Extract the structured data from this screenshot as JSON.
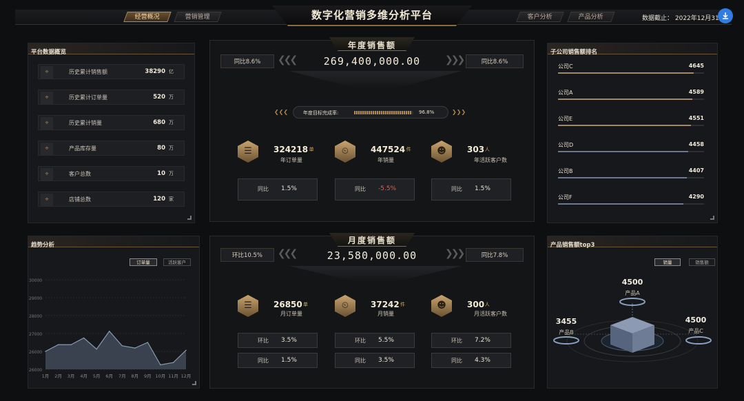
{
  "header": {
    "title": "数字化营销多维分析平台",
    "tabs_left": [
      "经营概况",
      "营销管理"
    ],
    "tabs_right": [
      "客户分析",
      "产品分析"
    ],
    "date_label": "数据截止：  2022年12月31日",
    "download_icon": "download-icon"
  },
  "overview": {
    "title": "平台数据概览",
    "items": [
      {
        "label": "历史累计销售额",
        "value": "38290",
        "unit": "亿"
      },
      {
        "label": "历史累计订单量",
        "value": "520",
        "unit": "万"
      },
      {
        "label": "历史累计销量",
        "value": "680",
        "unit": "万"
      },
      {
        "label": "产品库存量",
        "value": "80",
        "unit": "万"
      },
      {
        "label": "客户总数",
        "value": "10",
        "unit": "万"
      },
      {
        "label": "店铺总数",
        "value": "120",
        "unit": "家"
      }
    ]
  },
  "annual": {
    "title": "年度销售额",
    "yoy_left": "同比8.6%",
    "yoy_right": "同比8.6%",
    "value": "269,400,000.00",
    "target_label": "年度目标完成率:",
    "target_pct": "96.8%",
    "target_fraction": 0.968,
    "kpis": [
      {
        "value": "324218",
        "unit": "单",
        "label": "年订单量",
        "cmp_label": "同比",
        "cmp_value": "1.5%",
        "neg": false
      },
      {
        "value": "447524",
        "unit": "件",
        "label": "年销量",
        "cmp_label": "同比",
        "cmp_value": "-5.5%",
        "neg": true
      },
      {
        "value": "303",
        "unit": "人",
        "label": "年活跃客户数",
        "cmp_label": "同比",
        "cmp_value": "1.5%",
        "neg": false
      }
    ]
  },
  "monthly": {
    "title": "月度销售额",
    "mom_left": "环比10.5%",
    "yoy_right": "同比7.8%",
    "value": "23,580,000.00",
    "kpis": [
      {
        "value": "26850",
        "unit": "单",
        "label": "月订单量",
        "mom_label": "环比",
        "mom": "3.5%",
        "yoy_label": "同比",
        "yoy": "1.5%"
      },
      {
        "value": "37242",
        "unit": "件",
        "label": "月销量",
        "mom_label": "环比",
        "mom": "5.5%",
        "yoy_label": "同比",
        "yoy": "3.5%"
      },
      {
        "value": "300",
        "unit": "人",
        "label": "月活跃客户数",
        "mom_label": "环比",
        "mom": "7.2%",
        "yoy_label": "同比",
        "yoy": "4.3%"
      }
    ]
  },
  "ranking": {
    "title": "子公司销售额排名",
    "rows": [
      {
        "name": "公司C",
        "value": "4645",
        "color": "#a08868"
      },
      {
        "name": "公司A",
        "value": "4589",
        "color": "#a08868"
      },
      {
        "name": "公司E",
        "value": "4551",
        "color": "#a08868"
      },
      {
        "name": "公司D",
        "value": "4458",
        "color": "#6a7890"
      },
      {
        "name": "公司B",
        "value": "4407",
        "color": "#6a7890"
      },
      {
        "name": "公司F",
        "value": "4290",
        "color": "#6a7890"
      }
    ]
  },
  "trend": {
    "title": "趋势分析",
    "tabs": [
      "订单量",
      "活跃客户"
    ]
  },
  "chart_data": {
    "type": "area",
    "categories": [
      "1月",
      "2月",
      "3月",
      "4月",
      "5月",
      "6月",
      "7月",
      "8月",
      "9月",
      "10月",
      "11月",
      "12月"
    ],
    "values": [
      26800,
      27100,
      27100,
      27400,
      26900,
      27700,
      27050,
      26950,
      27200,
      26200,
      26300,
      26850
    ],
    "ylim": [
      26000,
      30000
    ],
    "yticks": [
      "30000",
      "29000",
      "28000",
      "27000",
      "26000",
      "26000"
    ],
    "grid": true,
    "color": "#8a9ab0"
  },
  "top3": {
    "title": "产品销售额top3",
    "tabs": [
      "销量",
      "销售额"
    ],
    "products": [
      {
        "value": "4500",
        "name": "产品A"
      },
      {
        "value": "3455",
        "name": "产品B"
      },
      {
        "value": "4500",
        "name": "产品C"
      }
    ]
  }
}
